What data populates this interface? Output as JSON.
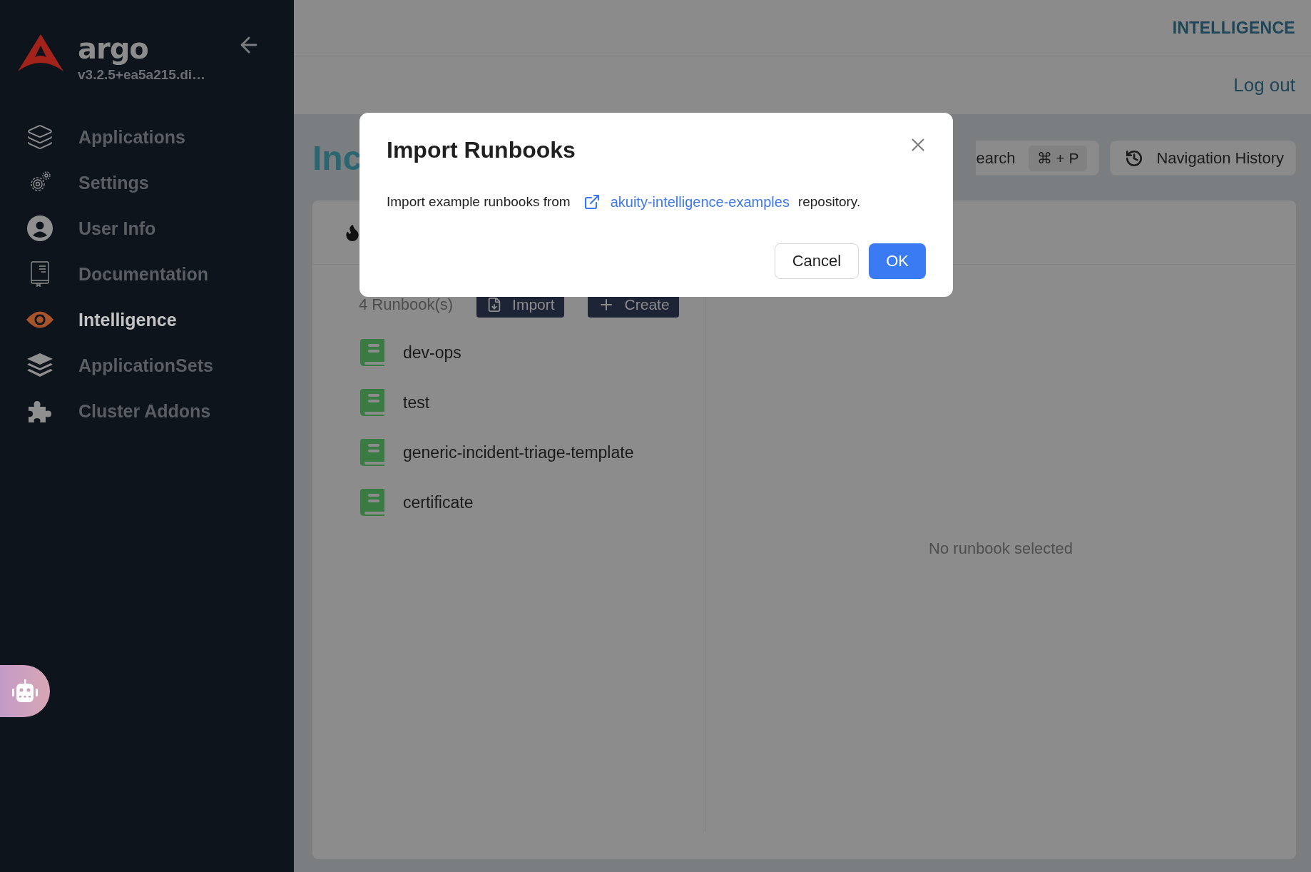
{
  "sidebar": {
    "brand": "argo",
    "version": "v3.2.5+ea5a215.di…",
    "items": [
      {
        "label": "Applications",
        "kind": "layers",
        "selected": false
      },
      {
        "label": "Settings",
        "kind": "gears",
        "selected": false
      },
      {
        "label": "User Info",
        "kind": "user",
        "selected": false
      },
      {
        "label": "Documentation",
        "kind": "book",
        "selected": false
      },
      {
        "label": "Intelligence",
        "kind": "eye",
        "selected": true
      },
      {
        "label": "ApplicationSets",
        "kind": "stack",
        "selected": false
      },
      {
        "label": "Cluster Addons",
        "kind": "puzzle",
        "selected": false
      }
    ]
  },
  "header": {
    "section": "INTELLIGENCE",
    "logout": "Log out"
  },
  "page": {
    "title": "Inc",
    "search": {
      "label": "earch",
      "shortcut": "⌘ + P"
    },
    "history_button": "Navigation History"
  },
  "runbooks": {
    "count": "4 Runbook(s)",
    "import_button": "Import",
    "create_button": "Create",
    "items": [
      {
        "name": "dev-ops"
      },
      {
        "name": "test"
      },
      {
        "name": "generic-incident-triage-template"
      },
      {
        "name": "certificate"
      }
    ],
    "empty": "No runbook selected"
  },
  "dialog": {
    "title": "Import Runbooks",
    "text_before": "Import example runbooks from",
    "link": "akuity-intelligence-examples",
    "text_after": "repository.",
    "cancel": "Cancel",
    "ok": "OK"
  }
}
